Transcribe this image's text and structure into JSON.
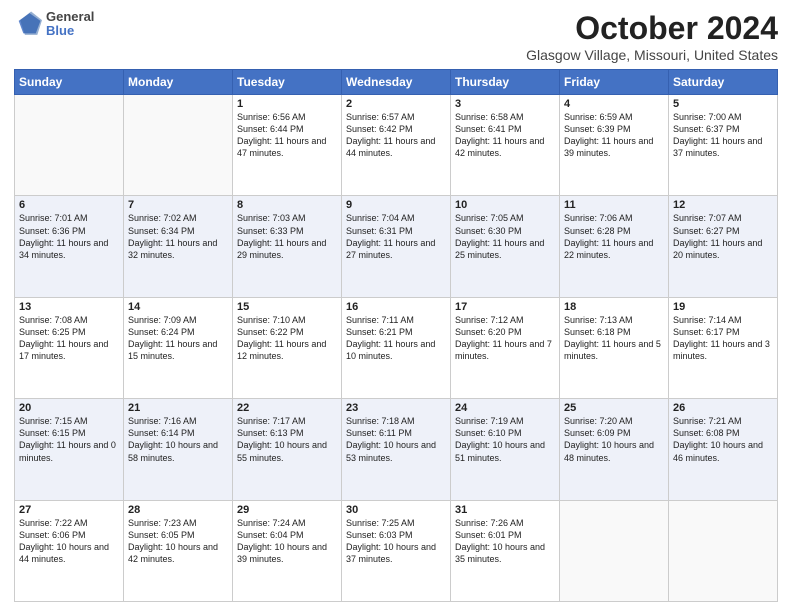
{
  "header": {
    "logo_line1": "General",
    "logo_line2": "Blue",
    "title": "October 2024",
    "subtitle": "Glasgow Village, Missouri, United States"
  },
  "weekdays": [
    "Sunday",
    "Monday",
    "Tuesday",
    "Wednesday",
    "Thursday",
    "Friday",
    "Saturday"
  ],
  "weeks": [
    [
      {
        "day": "",
        "info": ""
      },
      {
        "day": "",
        "info": ""
      },
      {
        "day": "1",
        "info": "Sunrise: 6:56 AM\nSunset: 6:44 PM\nDaylight: 11 hours and 47 minutes."
      },
      {
        "day": "2",
        "info": "Sunrise: 6:57 AM\nSunset: 6:42 PM\nDaylight: 11 hours and 44 minutes."
      },
      {
        "day": "3",
        "info": "Sunrise: 6:58 AM\nSunset: 6:41 PM\nDaylight: 11 hours and 42 minutes."
      },
      {
        "day": "4",
        "info": "Sunrise: 6:59 AM\nSunset: 6:39 PM\nDaylight: 11 hours and 39 minutes."
      },
      {
        "day": "5",
        "info": "Sunrise: 7:00 AM\nSunset: 6:37 PM\nDaylight: 11 hours and 37 minutes."
      }
    ],
    [
      {
        "day": "6",
        "info": "Sunrise: 7:01 AM\nSunset: 6:36 PM\nDaylight: 11 hours and 34 minutes."
      },
      {
        "day": "7",
        "info": "Sunrise: 7:02 AM\nSunset: 6:34 PM\nDaylight: 11 hours and 32 minutes."
      },
      {
        "day": "8",
        "info": "Sunrise: 7:03 AM\nSunset: 6:33 PM\nDaylight: 11 hours and 29 minutes."
      },
      {
        "day": "9",
        "info": "Sunrise: 7:04 AM\nSunset: 6:31 PM\nDaylight: 11 hours and 27 minutes."
      },
      {
        "day": "10",
        "info": "Sunrise: 7:05 AM\nSunset: 6:30 PM\nDaylight: 11 hours and 25 minutes."
      },
      {
        "day": "11",
        "info": "Sunrise: 7:06 AM\nSunset: 6:28 PM\nDaylight: 11 hours and 22 minutes."
      },
      {
        "day": "12",
        "info": "Sunrise: 7:07 AM\nSunset: 6:27 PM\nDaylight: 11 hours and 20 minutes."
      }
    ],
    [
      {
        "day": "13",
        "info": "Sunrise: 7:08 AM\nSunset: 6:25 PM\nDaylight: 11 hours and 17 minutes."
      },
      {
        "day": "14",
        "info": "Sunrise: 7:09 AM\nSunset: 6:24 PM\nDaylight: 11 hours and 15 minutes."
      },
      {
        "day": "15",
        "info": "Sunrise: 7:10 AM\nSunset: 6:22 PM\nDaylight: 11 hours and 12 minutes."
      },
      {
        "day": "16",
        "info": "Sunrise: 7:11 AM\nSunset: 6:21 PM\nDaylight: 11 hours and 10 minutes."
      },
      {
        "day": "17",
        "info": "Sunrise: 7:12 AM\nSunset: 6:20 PM\nDaylight: 11 hours and 7 minutes."
      },
      {
        "day": "18",
        "info": "Sunrise: 7:13 AM\nSunset: 6:18 PM\nDaylight: 11 hours and 5 minutes."
      },
      {
        "day": "19",
        "info": "Sunrise: 7:14 AM\nSunset: 6:17 PM\nDaylight: 11 hours and 3 minutes."
      }
    ],
    [
      {
        "day": "20",
        "info": "Sunrise: 7:15 AM\nSunset: 6:15 PM\nDaylight: 11 hours and 0 minutes."
      },
      {
        "day": "21",
        "info": "Sunrise: 7:16 AM\nSunset: 6:14 PM\nDaylight: 10 hours and 58 minutes."
      },
      {
        "day": "22",
        "info": "Sunrise: 7:17 AM\nSunset: 6:13 PM\nDaylight: 10 hours and 55 minutes."
      },
      {
        "day": "23",
        "info": "Sunrise: 7:18 AM\nSunset: 6:11 PM\nDaylight: 10 hours and 53 minutes."
      },
      {
        "day": "24",
        "info": "Sunrise: 7:19 AM\nSunset: 6:10 PM\nDaylight: 10 hours and 51 minutes."
      },
      {
        "day": "25",
        "info": "Sunrise: 7:20 AM\nSunset: 6:09 PM\nDaylight: 10 hours and 48 minutes."
      },
      {
        "day": "26",
        "info": "Sunrise: 7:21 AM\nSunset: 6:08 PM\nDaylight: 10 hours and 46 minutes."
      }
    ],
    [
      {
        "day": "27",
        "info": "Sunrise: 7:22 AM\nSunset: 6:06 PM\nDaylight: 10 hours and 44 minutes."
      },
      {
        "day": "28",
        "info": "Sunrise: 7:23 AM\nSunset: 6:05 PM\nDaylight: 10 hours and 42 minutes."
      },
      {
        "day": "29",
        "info": "Sunrise: 7:24 AM\nSunset: 6:04 PM\nDaylight: 10 hours and 39 minutes."
      },
      {
        "day": "30",
        "info": "Sunrise: 7:25 AM\nSunset: 6:03 PM\nDaylight: 10 hours and 37 minutes."
      },
      {
        "day": "31",
        "info": "Sunrise: 7:26 AM\nSunset: 6:01 PM\nDaylight: 10 hours and 35 minutes."
      },
      {
        "day": "",
        "info": ""
      },
      {
        "day": "",
        "info": ""
      }
    ]
  ]
}
